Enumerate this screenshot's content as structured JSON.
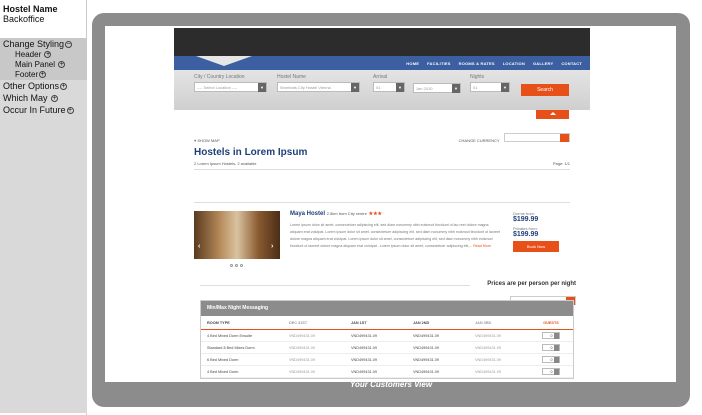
{
  "sidebar": {
    "title": "Hostel Name",
    "subtitle": "Backoffice",
    "groups": [
      {
        "label": "Change Styling",
        "state": "minus",
        "children": [
          "Header",
          "Main Panel",
          "Footer"
        ]
      },
      {
        "label": "Other Options",
        "state": "plus"
      },
      {
        "label": "Which May",
        "state": "plus"
      },
      {
        "label": "Occur In Future",
        "state": "plus"
      }
    ]
  },
  "caption": "Your Customers View",
  "site": {
    "nav": [
      "HOME",
      "FACILITIES",
      "ROOMS & RATES",
      "LOCATION",
      "GALLERY",
      "CONTACT"
    ],
    "search": {
      "city_label": "City / Country Location",
      "city_value": "---- Select Location ----",
      "hostel_label": "Hostel Name",
      "hostel_value": "Wombats City Hostel Vienna",
      "arrival_label": "Arrival",
      "arrival_day": "01",
      "arrival_month": "Jan 2010",
      "nights_label": "Nights",
      "nights_value": "01",
      "button": "Search"
    },
    "show_map": "SHOW MAP",
    "change_currency": "CHANGE CURRENCY",
    "title": "Hostels in Lorem Ipsum",
    "count_text": "2 Lorem Ipsum Hostels, 2 available",
    "page_text": "Page: 1/1",
    "hostel": {
      "name": "Maya Hostel",
      "distance": "2.5km from City centre",
      "stars": "★★★",
      "desc": "Lorem ipsum dolor sit amet, consectetuer adipiscing elit, sed diam nonummy nibh euismod tincidunt ut lao reet dolore magna aliquam erat volutpat. Lorem ipsum dolor sit amet, consectetuer adipiscing elit, sed diam nonummy nibh euismod tincidunt ut laoreet dolore magna aliquam erat volutpat. Lorem ipsum dolor sit amet, consectetuer adipiscing elit, sed diam nonummy nibh euismod tincidunt ut laoreet dolore magna aliquam erat volutpat...Lorem ipsum dolor sit amet, consectetuer adipiscing elit,...",
      "read_more": "Read More",
      "dorms_label": "Dorms from:",
      "dorms_price": "$199.99",
      "privates_label": "Privates from:",
      "privates_price": "$199.99",
      "book": "Book Now"
    },
    "prices_note": "Prices are per person per night",
    "table": {
      "title": "Min/Max  Night Messaging",
      "headers": [
        "ROOM TYPE",
        "DEC 31ST",
        "JAN 1ST",
        "JAN 2ND",
        "JAN 3RD",
        "GUESTS"
      ],
      "rows": [
        [
          "4 Bed Mixed Dorm Ensuite",
          "VND499431.09",
          "VND499431.09",
          "VND499431.09",
          "VND499431.09",
          "0"
        ],
        [
          "Standard 8 Bed Mixes Dorm",
          "VND499431.09",
          "VND499431.09",
          "VND499431.09",
          "VND499431.09",
          "0"
        ],
        [
          "6 Bed Mixed Dorm",
          "VND499431.09",
          "VND499431.09",
          "VND499431.09",
          "VND499431.09",
          "0"
        ],
        [
          "4 Bed Mixed Dorm",
          "VND499431.09",
          "VND499431.09",
          "VND499431.09",
          "VND499431.09",
          "0"
        ]
      ]
    }
  }
}
